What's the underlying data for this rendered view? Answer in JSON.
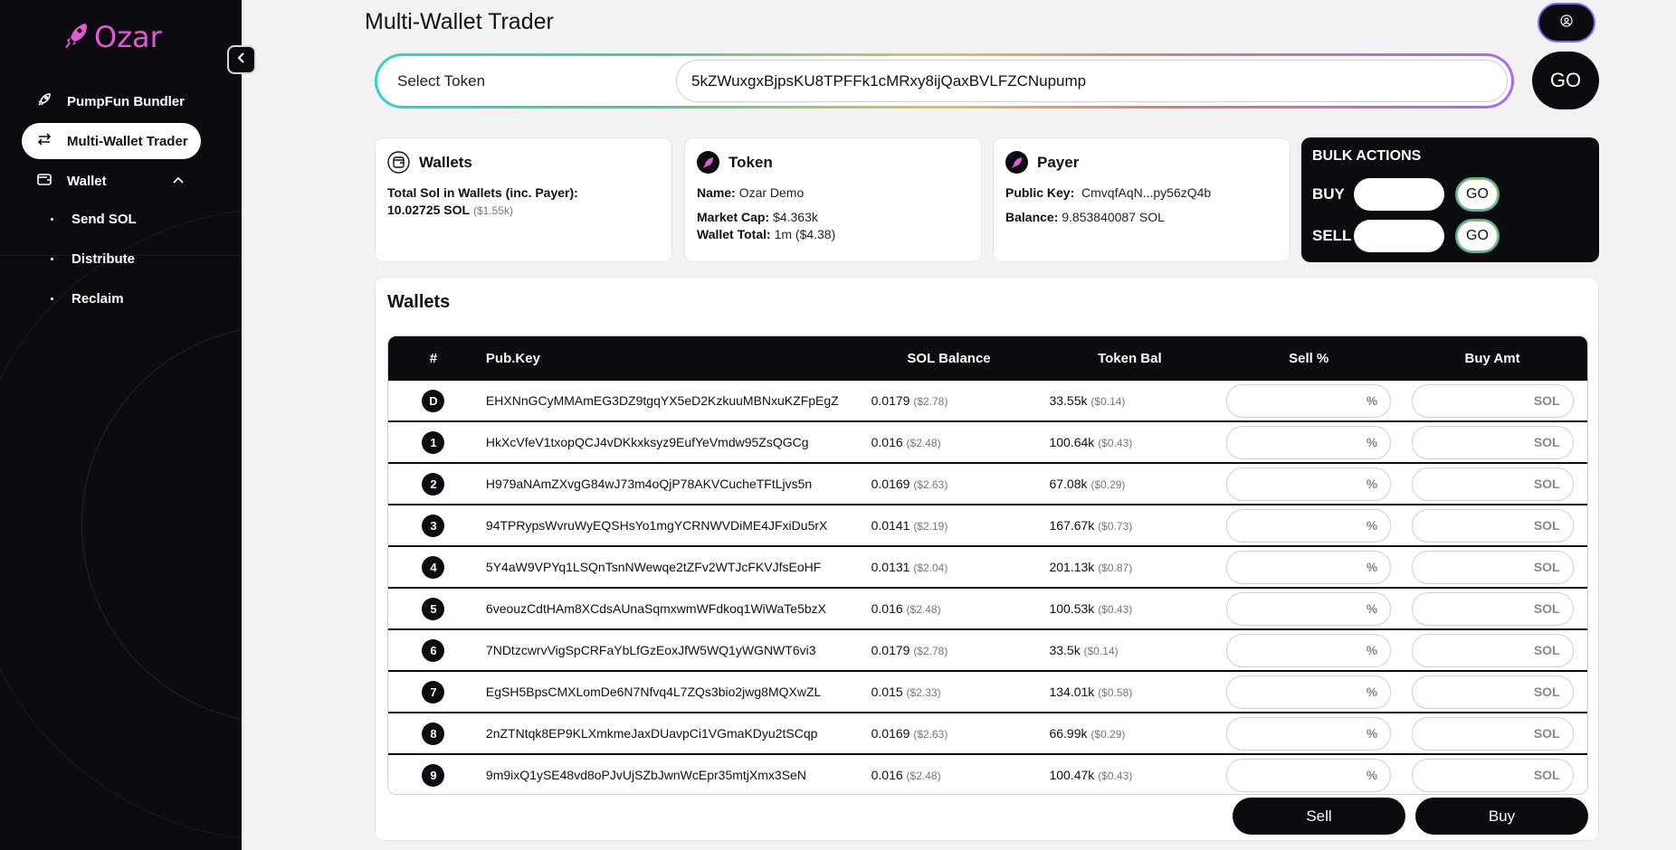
{
  "app": {
    "name": "Ozar",
    "page_title": "Multi-Wallet Trader"
  },
  "sidebar": {
    "items": [
      {
        "label": "PumpFun Bundler"
      },
      {
        "label": "Multi-Wallet Trader"
      },
      {
        "label": "Wallet"
      }
    ],
    "sub_items": [
      {
        "label": "Send SOL"
      },
      {
        "label": "Distribute"
      },
      {
        "label": "Reclaim"
      }
    ]
  },
  "token_bar": {
    "select_label": "Select Token",
    "token_address": "5kZWuxgxBjpsKU8TPFFk1cMRxy8ijQaxBVLFZCNupump",
    "go_label": "GO"
  },
  "wallets_card": {
    "title": "Wallets",
    "total_label": "Total Sol in Wallets (inc. Payer):",
    "total_value": "10.02725 SOL",
    "total_usd": "($1.55k)"
  },
  "token_card": {
    "title": "Token",
    "name_label": "Name:",
    "name_value": "Ozar Demo",
    "mcap_label": "Market Cap:",
    "mcap_value": "$4.363k",
    "wallet_total_label": "Wallet Total:",
    "wallet_total_value": "1m ($4.38)"
  },
  "payer_card": {
    "title": "Payer",
    "key_label": "Public Key:",
    "key_value": "CmvqfAqN...py56zQ4b",
    "balance_label": "Balance:",
    "balance_value": "9.853840087 SOL"
  },
  "bulk_actions": {
    "title": "BULK ACTIONS",
    "buy_label": "BUY",
    "sell_label": "SELL",
    "go_label": "GO"
  },
  "wallets_table": {
    "title": "Wallets",
    "headers": {
      "num": "#",
      "key": "Pub.Key",
      "sol": "SOL Balance",
      "token": "Token Bal",
      "sell": "Sell %",
      "buy": "Buy Amt"
    },
    "sell_suffix": "%",
    "buy_suffix": "SOL",
    "rows": [
      {
        "id": "D",
        "key": "EHXNnGCyMMAmEG3DZ9tgqYX5eD2KzkuuMBNxuKZFpEgZ",
        "sol": "0.0179",
        "sol_usd": "($2.78)",
        "tok": "33.55k",
        "tok_usd": "($0.14)"
      },
      {
        "id": "1",
        "key": "HkXcVfeV1txopQCJ4vDKkxksyz9EufYeVmdw95ZsQGCg",
        "sol": "0.016",
        "sol_usd": "($2.48)",
        "tok": "100.64k",
        "tok_usd": "($0.43)"
      },
      {
        "id": "2",
        "key": "H979aNAmZXvgG84wJ73m4oQjP78AKVCucheTFtLjvs5n",
        "sol": "0.0169",
        "sol_usd": "($2.63)",
        "tok": "67.08k",
        "tok_usd": "($0.29)"
      },
      {
        "id": "3",
        "key": "94TPRypsWvruWyEQSHsYo1mgYCRNWVDiME4JFxiDu5rX",
        "sol": "0.0141",
        "sol_usd": "($2.19)",
        "tok": "167.67k",
        "tok_usd": "($0.73)"
      },
      {
        "id": "4",
        "key": "5Y4aW9VPYq1LSQnTsnNWewqe2tZFv2WTJcFKVJfsEoHF",
        "sol": "0.0131",
        "sol_usd": "($2.04)",
        "tok": "201.13k",
        "tok_usd": "($0.87)"
      },
      {
        "id": "5",
        "key": "6veouzCdtHAm8XCdsAUnaSqmxwmWFdkoq1WiWaTe5bzX",
        "sol": "0.016",
        "sol_usd": "($2.48)",
        "tok": "100.53k",
        "tok_usd": "($0.43)"
      },
      {
        "id": "6",
        "key": "7NDtzcwrvVigSpCRFaYbLfGzEoxJfW5WQ1yWGNWT6vi3",
        "sol": "0.0179",
        "sol_usd": "($2.78)",
        "tok": "33.5k",
        "tok_usd": "($0.14)"
      },
      {
        "id": "7",
        "key": "EgSH5BpsCMXLomDe6N7Nfvq4L7ZQs3bio2jwg8MQXwZL",
        "sol": "0.015",
        "sol_usd": "($2.33)",
        "tok": "134.01k",
        "tok_usd": "($0.58)"
      },
      {
        "id": "8",
        "key": "2nZTNtqk8EP9KLXmkmeJaxDUavpCi1VGmaKDyu2tSCqp",
        "sol": "0.0169",
        "sol_usd": "($2.63)",
        "tok": "66.99k",
        "tok_usd": "($0.29)"
      },
      {
        "id": "9",
        "key": "9m9ixQ1ySE48vd8oPJvUjSZbJwnWcEpr35mtjXmx3SeN",
        "sol": "0.016",
        "sol_usd": "($2.48)",
        "tok": "100.47k",
        "tok_usd": "($0.43)"
      }
    ]
  },
  "actions": {
    "sell_label": "Sell",
    "buy_label": "Buy"
  },
  "colors": {
    "brand": "#e05ad6",
    "dark": "#0b0b10",
    "accent_purple": "#7b6cf6"
  }
}
